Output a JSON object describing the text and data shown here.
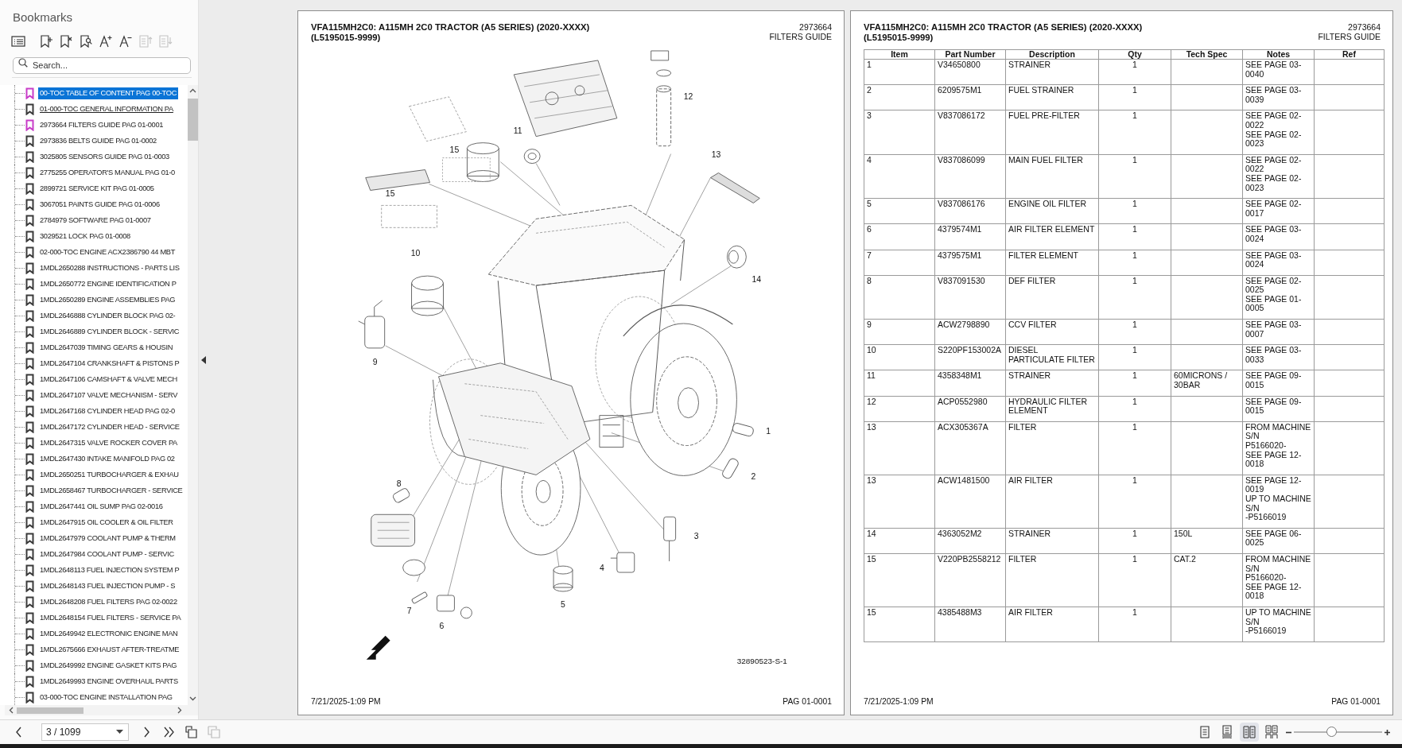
{
  "sidebar": {
    "title": "Bookmarks",
    "tools": [
      {
        "kind": "list",
        "disabled": false
      },
      {
        "kind": "add",
        "disabled": false
      },
      {
        "kind": "delete",
        "disabled": false
      },
      {
        "kind": "find",
        "disabled": false
      },
      {
        "kind": "larger",
        "disabled": false
      },
      {
        "kind": "smaller",
        "disabled": false
      },
      {
        "kind": "up",
        "disabled": true
      },
      {
        "kind": "down",
        "disabled": true
      }
    ],
    "search": {
      "placeholder": "Search..."
    },
    "bookmarks": [
      {
        "label": "00-TOC TABLE OF CONTENT PAG 00-TOC",
        "selected": true,
        "hovered": false,
        "color": "#c83cc8"
      },
      {
        "label": "01-000-TOC GENERAL INFORMATION PA",
        "selected": false,
        "hovered": true,
        "color": "#3a3a3a"
      },
      {
        "label": "2973664 FILTERS GUIDE PAG 01-0001",
        "selected": false,
        "hovered": false,
        "color": "#c83cc8"
      },
      {
        "label": "2973836 BELTS GUIDE PAG 01-0002",
        "selected": false,
        "hovered": false,
        "color": "#3a3a3a"
      },
      {
        "label": "3025805 SENSORS GUIDE PAG 01-0003",
        "selected": false,
        "hovered": false,
        "color": "#3a3a3a"
      },
      {
        "label": "2775255 OPERATOR'S MANUAL PAG 01-0",
        "selected": false,
        "hovered": false,
        "color": "#3a3a3a"
      },
      {
        "label": "2899721 SERVICE KIT PAG 01-0005",
        "selected": false,
        "hovered": false,
        "color": "#3a3a3a"
      },
      {
        "label": "3067051 PAINTS GUIDE PAG 01-0006",
        "selected": false,
        "hovered": false,
        "color": "#3a3a3a"
      },
      {
        "label": "2784979 SOFTWARE PAG 01-0007",
        "selected": false,
        "hovered": false,
        "color": "#3a3a3a"
      },
      {
        "label": "3029521 LOCK PAG 01-0008",
        "selected": false,
        "hovered": false,
        "color": "#3a3a3a"
      },
      {
        "label": "02-000-TOC ENGINE ACX2386790 44 MBT",
        "selected": false,
        "hovered": false,
        "color": "#3a3a3a"
      },
      {
        "label": "1MDL2650288 INSTRUCTIONS - PARTS LIS",
        "selected": false,
        "hovered": false,
        "color": "#3a3a3a"
      },
      {
        "label": "1MDL2650772 ENGINE IDENTIFICATION P",
        "selected": false,
        "hovered": false,
        "color": "#3a3a3a"
      },
      {
        "label": "1MDL2650289 ENGINE ASSEMBLIES PAG",
        "selected": false,
        "hovered": false,
        "color": "#3a3a3a"
      },
      {
        "label": "1MDL2646888 CYLINDER BLOCK PAG 02-",
        "selected": false,
        "hovered": false,
        "color": "#3a3a3a"
      },
      {
        "label": "1MDL2646889 CYLINDER BLOCK - SERVIC",
        "selected": false,
        "hovered": false,
        "color": "#3a3a3a"
      },
      {
        "label": "1MDL2647039 TIMING GEARS & HOUSIN",
        "selected": false,
        "hovered": false,
        "color": "#3a3a3a"
      },
      {
        "label": "1MDL2647104 CRANKSHAFT & PISTONS P",
        "selected": false,
        "hovered": false,
        "color": "#3a3a3a"
      },
      {
        "label": "1MDL2647106 CAMSHAFT & VALVE MECH",
        "selected": false,
        "hovered": false,
        "color": "#3a3a3a"
      },
      {
        "label": "1MDL2647107 VALVE MECHANISM - SERV",
        "selected": false,
        "hovered": false,
        "color": "#3a3a3a"
      },
      {
        "label": "1MDL2647168 CYLINDER HEAD PAG 02-0",
        "selected": false,
        "hovered": false,
        "color": "#3a3a3a"
      },
      {
        "label": "1MDL2647172 CYLINDER HEAD - SERVICE",
        "selected": false,
        "hovered": false,
        "color": "#3a3a3a"
      },
      {
        "label": "1MDL2647315 VALVE ROCKER COVER PA",
        "selected": false,
        "hovered": false,
        "color": "#3a3a3a"
      },
      {
        "label": "1MDL2647430 INTAKE MANIFOLD PAG 02",
        "selected": false,
        "hovered": false,
        "color": "#3a3a3a"
      },
      {
        "label": "1MDL2650251 TURBOCHARGER & EXHAU",
        "selected": false,
        "hovered": false,
        "color": "#3a3a3a"
      },
      {
        "label": "1MDL2658467 TURBOCHARGER - SERVICE",
        "selected": false,
        "hovered": false,
        "color": "#3a3a3a"
      },
      {
        "label": "1MDL2647441 OIL SUMP PAG 02-0016",
        "selected": false,
        "hovered": false,
        "color": "#3a3a3a"
      },
      {
        "label": "1MDL2647915 OIL COOLER & OIL FILTER",
        "selected": false,
        "hovered": false,
        "color": "#3a3a3a"
      },
      {
        "label": "1MDL2647979 COOLANT PUMP & THERM",
        "selected": false,
        "hovered": false,
        "color": "#3a3a3a"
      },
      {
        "label": "1MDL2647984 COOLANT PUMP - SERVIC",
        "selected": false,
        "hovered": false,
        "color": "#3a3a3a"
      },
      {
        "label": "1MDL2648113 FUEL INJECTION SYSTEM P",
        "selected": false,
        "hovered": false,
        "color": "#3a3a3a"
      },
      {
        "label": "1MDL2648143 FUEL INJECTION PUMP - S",
        "selected": false,
        "hovered": false,
        "color": "#3a3a3a"
      },
      {
        "label": "1MDL2648208 FUEL FILTERS PAG 02-0022",
        "selected": false,
        "hovered": false,
        "color": "#3a3a3a"
      },
      {
        "label": "1MDL2648154 FUEL FILTERS - SERVICE PA",
        "selected": false,
        "hovered": false,
        "color": "#3a3a3a"
      },
      {
        "label": "1MDL2649942 ELECTRONIC ENGINE MAN",
        "selected": false,
        "hovered": false,
        "color": "#3a3a3a"
      },
      {
        "label": "1MDL2675666 EXHAUST AFTER-TREATME",
        "selected": false,
        "hovered": false,
        "color": "#3a3a3a"
      },
      {
        "label": "1MDL2649992 ENGINE GASKET KITS PAG",
        "selected": false,
        "hovered": false,
        "color": "#3a3a3a"
      },
      {
        "label": "1MDL2649993 ENGINE OVERHAUL PARTS",
        "selected": false,
        "hovered": false,
        "color": "#3a3a3a"
      },
      {
        "label": "03-000-TOC ENGINE INSTALLATION PAG",
        "selected": false,
        "hovered": false,
        "color": "#3a3a3a"
      }
    ]
  },
  "left_page": {
    "title_lines": [
      "VFA115MH2C0: A115MH 2C0 TRACTOR (A5 SERIES) (2020-XXXX)",
      "(L5195015-9999)"
    ],
    "doc_number": "2973664",
    "doc_title": "FILTERS GUIDE",
    "callouts": [
      "12",
      "11",
      "15",
      "13",
      "15",
      "10",
      "14",
      "9",
      "1",
      "2",
      "8",
      "3",
      "4",
      "5",
      "7",
      "6"
    ],
    "figure_id": "32890523-S-1",
    "footer_date": "7/21/2025-1:09 PM",
    "footer_page": "PAG 01-0001"
  },
  "right_page": {
    "title_lines": [
      "VFA115MH2C0: A115MH 2C0 TRACTOR (A5 SERIES) (2020-XXXX)",
      "(L5195015-9999)"
    ],
    "doc_number": "2973664",
    "doc_title": "FILTERS GUIDE",
    "table": {
      "columns": [
        "Item",
        "Part Number",
        "Description",
        "Qty",
        "Tech Spec",
        "Notes",
        "Ref"
      ],
      "rows": [
        {
          "item": "1",
          "part_number": "V34650800",
          "description": "STRAINER",
          "qty": "1",
          "notes": [
            "SEE PAGE 03-",
            "0040"
          ]
        },
        {
          "item": "2",
          "part_number": "6209575M1",
          "description": "FUEL STRAINER",
          "qty": "1",
          "notes": [
            "SEE PAGE 03-",
            "0039"
          ]
        },
        {
          "item": "3",
          "part_number": "V837086172",
          "description": "FUEL PRE-FILTER",
          "qty": "1",
          "notes": [
            "SEE PAGE 02-",
            "0022",
            "SEE PAGE 02-",
            "0023"
          ]
        },
        {
          "item": "4",
          "part_number": "V837086099",
          "description": "MAIN FUEL FILTER",
          "qty": "1",
          "notes": [
            "SEE PAGE 02-",
            "0022",
            "SEE PAGE 02-",
            "0023"
          ]
        },
        {
          "item": "5",
          "part_number": "V837086176",
          "description": "ENGINE OIL FILTER",
          "qty": "1",
          "notes": [
            "SEE PAGE 02-",
            "0017"
          ]
        },
        {
          "item": "6",
          "part_number": "4379574M1",
          "description": "AIR FILTER ELEMENT",
          "qty": "1",
          "notes": [
            "SEE PAGE 03-",
            "0024"
          ]
        },
        {
          "item": "7",
          "part_number": "4379575M1",
          "description": "FILTER ELEMENT",
          "qty": "1",
          "notes": [
            "SEE PAGE 03-",
            "0024"
          ]
        },
        {
          "item": "8",
          "part_number": "V837091530",
          "description": "DEF FILTER",
          "qty": "1",
          "notes": [
            "SEE PAGE 02-",
            "0025",
            "SEE PAGE 01-",
            "0005"
          ]
        },
        {
          "item": "9",
          "part_number": "ACW2798890",
          "description": "CCV FILTER",
          "qty": "1",
          "notes": [
            "SEE PAGE 03-",
            "0007"
          ]
        },
        {
          "item": "10",
          "part_number": "S220PF153002A",
          "description": "DIESEL PARTICULATE FILTER",
          "qty": "1",
          "notes": [
            "SEE PAGE 03-",
            "0033"
          ]
        },
        {
          "item": "11",
          "part_number": "4358348M1",
          "description": "STRAINER",
          "qty": "1",
          "tech_spec": "60MICRONS / 30BAR",
          "notes": [
            "SEE PAGE 09-",
            "0015"
          ]
        },
        {
          "item": "12",
          "part_number": "ACP0552980",
          "description": "HYDRAULIC FILTER ELEMENT",
          "qty": "1",
          "notes": [
            "SEE PAGE 09-",
            "0015"
          ]
        },
        {
          "item": "13",
          "part_number": "ACX305367A",
          "description": "FILTER",
          "qty": "1",
          "notes": [
            "FROM MACHINE",
            "S/N",
            "P5166020-",
            "SEE PAGE 12-",
            "0018"
          ]
        },
        {
          "item": "13",
          "part_number": "ACW1481500",
          "description": "AIR FILTER",
          "qty": "1",
          "notes": [
            "SEE PAGE 12-",
            "0019",
            "UP TO MACHINE",
            "S/N",
            "-P5166019"
          ]
        },
        {
          "item": "14",
          "part_number": "4363052M2",
          "description": "STRAINER",
          "qty": "1",
          "tech_spec": "150L",
          "notes": [
            "SEE PAGE 06-",
            "0025"
          ]
        },
        {
          "item": "15",
          "part_number": "V220PB2558212",
          "description": "FILTER",
          "qty": "1",
          "tech_spec": "CAT.2",
          "notes": [
            "FROM MACHINE",
            "S/N",
            "P5166020-",
            "SEE PAGE 12-",
            "0018"
          ]
        },
        {
          "item": "15",
          "part_number": "4385488M3",
          "description": "AIR FILTER",
          "qty": "1",
          "notes": [
            "UP TO MACHINE",
            "S/N",
            "-P5166019"
          ]
        }
      ]
    },
    "footer_date": "7/21/2025-1:09 PM",
    "footer_page": "PAG 01-0001"
  },
  "toolbar": {
    "page_field": {
      "value": "3 / 1099"
    },
    "nav": [
      {
        "kind": "prev",
        "disabled": false
      },
      {
        "kind": "next",
        "disabled": false
      },
      {
        "kind": "last",
        "disabled": false
      },
      {
        "kind": "rotate",
        "disabled": false
      },
      {
        "kind": "compare",
        "disabled": true
      }
    ],
    "view_modes": [
      {
        "kind": "single",
        "selected": false
      },
      {
        "kind": "continuous",
        "selected": false
      },
      {
        "kind": "facing",
        "selected": true
      },
      {
        "kind": "facing_continuous",
        "selected": false
      }
    ],
    "zoom": {
      "level": 0.42
    }
  }
}
